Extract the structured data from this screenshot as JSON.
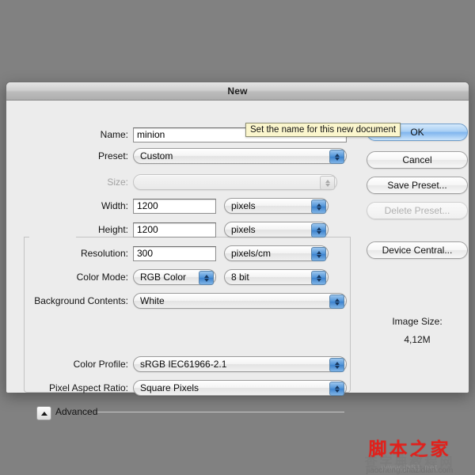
{
  "window": {
    "title": "New"
  },
  "tooltip": {
    "text": "Set the name for this new document"
  },
  "form": {
    "name": {
      "label": "Name:",
      "value": "minion"
    },
    "preset": {
      "label": "Preset:",
      "value": "Custom"
    },
    "size": {
      "label": "Size:",
      "value": ""
    },
    "width": {
      "label": "Width:",
      "value": "1200",
      "unit": "pixels"
    },
    "height": {
      "label": "Height:",
      "value": "1200",
      "unit": "pixels"
    },
    "resolution": {
      "label": "Resolution:",
      "value": "300",
      "unit": "pixels/cm"
    },
    "color_mode": {
      "label": "Color Mode:",
      "value": "RGB Color",
      "depth": "8 bit"
    },
    "background_contents": {
      "label": "Background Contents:",
      "value": "White"
    },
    "advanced": {
      "label": "Advanced",
      "expanded": true,
      "color_profile": {
        "label": "Color Profile:",
        "value": "sRGB IEC61966-2.1"
      },
      "pixel_aspect_ratio": {
        "label": "Pixel Aspect Ratio:",
        "value": "Square Pixels"
      }
    }
  },
  "buttons": {
    "ok": "OK",
    "cancel": "Cancel",
    "save_preset": "Save Preset...",
    "delete_preset": "Delete Preset...",
    "device_central": "Device Central..."
  },
  "image_size": {
    "label": "Image Size:",
    "value": "4,12M"
  },
  "watermark": {
    "main": "脚本之家",
    "sub": "查字典教程网",
    "url1": "www.jb51.net",
    "url2": "jiaocheng.chazidian.com"
  },
  "colors": {
    "desktop": "#818181",
    "dialog": "#ececec",
    "accent": "#4f93d8",
    "tooltip_bg": "#fbf6cd",
    "watermark_red": "#e0211c"
  }
}
